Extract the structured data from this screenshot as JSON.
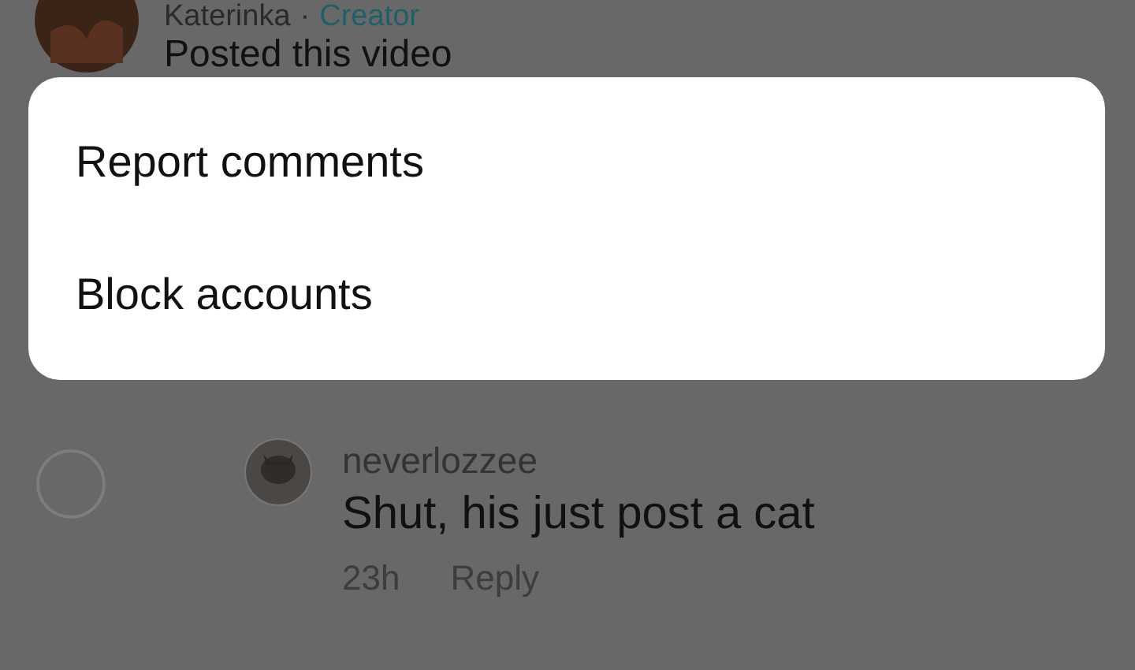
{
  "post": {
    "author": "Katerinka",
    "separator": "·",
    "badge": "Creator",
    "text": "Posted this video"
  },
  "menu": {
    "items": [
      {
        "label": "Report comments"
      },
      {
        "label": "Block accounts"
      }
    ]
  },
  "comment": {
    "selected": false,
    "username": "neverlozzee",
    "text": "Shut, his just post a cat",
    "time": "23h",
    "reply": "Reply"
  }
}
